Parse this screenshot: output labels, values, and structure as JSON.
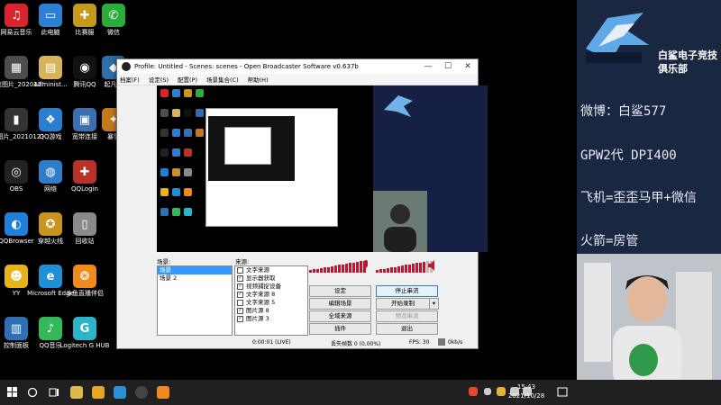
{
  "desktop": {
    "icons": [
      {
        "label": "网易云音乐",
        "glyph": "♫",
        "color": "#d9232e"
      },
      {
        "label": "此电脑",
        "glyph": "▭",
        "color": "#2d7fd3"
      },
      {
        "label": "比赛服",
        "glyph": "✚",
        "color": "#c59a1c"
      },
      {
        "label": "微信",
        "glyph": "✆",
        "color": "#2aae39"
      },
      {
        "label": "微信图片_2020121...",
        "glyph": "▦",
        "color": "#4d4d4d"
      },
      {
        "label": "Administ...",
        "glyph": "▤",
        "color": "#d7b35b"
      },
      {
        "label": "腾讯QQ",
        "glyph": "◉",
        "color": "#111"
      },
      {
        "label": "起凡游",
        "glyph": "◆",
        "color": "#2d6fa8"
      },
      {
        "label": "YY图片_20210123...",
        "glyph": "▮",
        "color": "#333"
      },
      {
        "label": "QQ游戏",
        "glyph": "❖",
        "color": "#2a7fd0"
      },
      {
        "label": "宽带连接",
        "glyph": "▣",
        "color": "#3a6fb0"
      },
      {
        "label": "暴雪",
        "glyph": "✦",
        "color": "#c27a1c"
      },
      {
        "label": "OBS",
        "glyph": "◎",
        "color": "#222"
      },
      {
        "label": "网络",
        "glyph": "◍",
        "color": "#2f7cc8"
      },
      {
        "label": "QQLogin",
        "glyph": "✚",
        "color": "#b8322a"
      },
      {
        "label": "QQBrowser",
        "glyph": "◐",
        "color": "#1f7fd9"
      },
      {
        "label": "穿越火线",
        "glyph": "✪",
        "color": "#c9941d"
      },
      {
        "label": "回收站",
        "glyph": "▯",
        "color": "#8a8a8a"
      },
      {
        "label": "YY",
        "glyph": "☻",
        "color": "#e8b21b"
      },
      {
        "label": "Microsoft Edge",
        "glyph": "e",
        "color": "#1f8fd6"
      },
      {
        "label": "斗鱼直播伴侣",
        "glyph": "❂",
        "color": "#f08a1c"
      },
      {
        "label": "控制面板",
        "glyph": "▥",
        "color": "#2e6fb6"
      },
      {
        "label": "QQ音乐",
        "glyph": "♪",
        "color": "#33b85a"
      },
      {
        "label": "Logitech G HUB",
        "glyph": "G",
        "color": "#2cb5c8"
      }
    ]
  },
  "obs": {
    "title": "Profile: Untitled - Scenes: scenes - Open Broadcaster Software v0.637b",
    "menu": [
      "档案(F)",
      "设定(S)",
      "配置(P)",
      "场景集合(C)",
      "帮助(H)"
    ],
    "scenes_label": "场景:",
    "scenes": [
      "场景",
      "场景 2"
    ],
    "sources_label": "来源:",
    "sources": [
      {
        "label": "文字来源",
        "checked": false
      },
      {
        "label": "显示器获取",
        "checked": true
      },
      {
        "label": "视频捕捉设备",
        "checked": true
      },
      {
        "label": "文字来源 8",
        "checked": true
      },
      {
        "label": "文字来源 5",
        "checked": false
      },
      {
        "label": "图片源 8",
        "checked": true
      },
      {
        "label": "图片源 3",
        "checked": true
      }
    ],
    "buttons": {
      "settings": "设定",
      "stop_stream": "停止串流",
      "edit_scene": "编辑场景",
      "start_record": "开始录制",
      "global_sources": "全域来源",
      "preview_stream": "预览串流",
      "plugins": "插件",
      "exit": "退出"
    },
    "status": {
      "time": "0:00:01 (LIVE)",
      "dropped": "丢失帧数  0 (0.00%)",
      "fps": "FPS:  30",
      "bitrate": "0kb/s"
    }
  },
  "stream_overlay": {
    "club_name_line1": "白鲨电子竞技",
    "club_name_line2": "俱乐部",
    "lines": [
      "微博：白鲨577",
      "GPW2代 DPI400",
      "飞机=歪歪马甲+微信",
      "火箭=房管"
    ]
  },
  "taskbar": {
    "time": "15:43",
    "date": "2021/10/28"
  }
}
